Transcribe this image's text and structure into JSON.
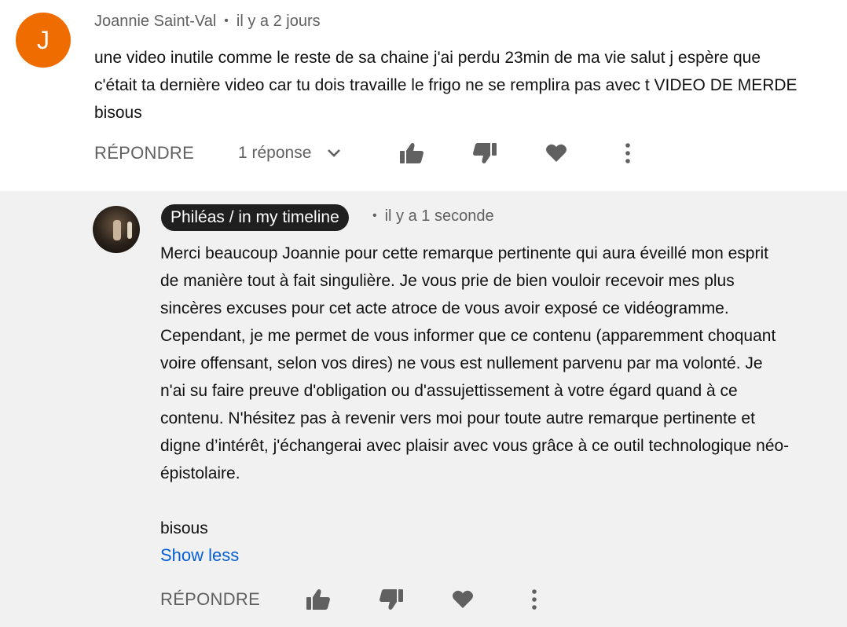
{
  "comment": {
    "avatar_letter": "J",
    "author": "Joannie Saint-Val",
    "separator": "•",
    "time": "il y a 2 jours",
    "text_lines": [
      "une video inutile comme le reste de sa chaine j'ai perdu 23min de ma vie salut j espère que",
      "c'était ta dernière video car tu dois travaille le frigo ne se remplira pas avec t VIDEO DE MERDE",
      "bisous"
    ],
    "reply_label": "RÉPONDRE",
    "replies_label": "1 réponse"
  },
  "reply": {
    "author": "Philéas / in my timeline",
    "separator": "•",
    "time": "il y a 1 seconde",
    "text_lines": [
      "Merci beaucoup Joannie pour cette remarque pertinente qui aura éveillé mon esprit",
      "de manière tout à fait singulière. Je vous prie de bien vouloir recevoir mes plus",
      "sincères excuses pour cet acte atroce de vous avoir exposé ce vidéogramme.",
      "Cependant, je me permet de vous informer que ce contenu (apparemment choquant",
      "voire offensant, selon vos dires) ne vous est nullement parvenu par ma volonté. Je",
      "n'ai su faire preuve d'obligation ou d'assujettissement à votre égard quand à ce",
      "contenu. N'hésitez pas à revenir vers moi pour toute autre remarque pertinente et",
      "digne d’intérêt, j'échangerai avec plaisir avec vous grâce à ce outil technologique néo-",
      "épistolaire.",
      "",
      "bisous"
    ],
    "show_less_label": "Show less",
    "reply_label": "RÉPONDRE"
  },
  "icons": {
    "like": "thumbs-up-icon",
    "dislike": "thumbs-down-icon",
    "heart": "heart-icon",
    "more": "more-vert-icon",
    "expand": "chevron-down-icon"
  },
  "colors": {
    "avatar_bg": "#ef6c00",
    "link_blue": "#065fd4",
    "secondary_text": "#606060",
    "reply_bg": "#f1f1f1",
    "pill_bg": "#1f1f1f"
  }
}
